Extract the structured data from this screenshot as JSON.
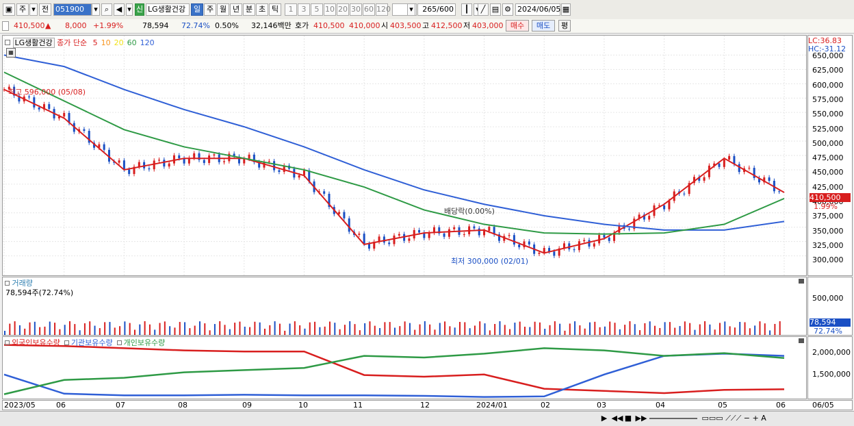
{
  "toolbar": {
    "period_buttons": [
      "주",
      "전"
    ],
    "code": "051900",
    "stock_badge": "신",
    "stock_name": "LG생활건강",
    "timeframes": [
      "일",
      "주",
      "월",
      "년",
      "분",
      "초",
      "틱"
    ],
    "active_timeframe": "일",
    "intervals": [
      "1",
      "3",
      "5",
      "10",
      "20",
      "30",
      "60",
      "120"
    ],
    "count": "265",
    "count_max": "/600",
    "date": "2024/06/05"
  },
  "info": {
    "price": "410,500",
    "change_arrow": "▲",
    "change": "8,000",
    "change_pct": "+1.99%",
    "volume": "78,594",
    "volume_pct": "72.74%",
    "turnover": "0.50%",
    "amount": "32,146백만",
    "quote_label": "호가",
    "ask": "410,500",
    "bid": "410,000",
    "open_label": "시",
    "open": "403,500",
    "high_label": "고",
    "high": "412,500",
    "low_label": "저",
    "low": "403,000",
    "buy_button": "매수",
    "sell_button": "매도",
    "eval_button": "평"
  },
  "price_panel": {
    "title": "LG생활건강",
    "ma_label": "종가 단순",
    "ma_periods": [
      {
        "label": "5",
        "color": "#d81e1e"
      },
      {
        "label": "10",
        "color": "#f7941d"
      },
      {
        "label": "20",
        "color": "#f2e21a"
      },
      {
        "label": "60",
        "color": "#2e9a45"
      },
      {
        "label": "120",
        "color": "#2f5fd6"
      }
    ],
    "lc": "LC:36.83",
    "hc": "HC:-31.12",
    "y_ticks": [
      "650,000",
      "625,000",
      "600,000",
      "575,000",
      "550,000",
      "525,000",
      "500,000",
      "475,000",
      "450,000",
      "425,000",
      "400,000",
      "375,000",
      "350,000",
      "325,000",
      "300,000"
    ],
    "current_price_tag": "410,500",
    "current_pct_tag": "1.99%",
    "annotation_high": "최고 596,000 (05/08)",
    "annotation_low": "최저 300,000 (02/01)",
    "annotation_dividend": "배당락(0.00%)"
  },
  "volume_panel": {
    "title": "거래량",
    "value": "78,594주(72.74%)",
    "y_tick": "500,000",
    "current_tag": "78,594",
    "current_pct": "72.74%"
  },
  "holdings_panel": {
    "legend": [
      {
        "label": "외국인보유수량",
        "color": "#d81e1e"
      },
      {
        "label": "기관보유수량",
        "color": "#2f5fd6"
      },
      {
        "label": "개인보유수량",
        "color": "#2e9a45"
      }
    ],
    "y_ticks": [
      "2,000,000",
      "1,500,000"
    ]
  },
  "x_axis": [
    "2023/05",
    "06",
    "07",
    "08",
    "09",
    "10",
    "11",
    "12",
    "2024/01",
    "02",
    "03",
    "04",
    "05",
    "06",
    "06/05"
  ],
  "chart_data": {
    "type": "line",
    "title": "",
    "x": [
      "2023/05",
      "06",
      "07",
      "08",
      "09",
      "10",
      "11",
      "12",
      "2024/01",
      "02",
      "03",
      "04",
      "05",
      "06"
    ],
    "series": [
      {
        "name": "종가",
        "values": [
          590000,
          540000,
          450000,
          470000,
          470000,
          440000,
          320000,
          340000,
          345000,
          305000,
          330000,
          390000,
          470000,
          410500
        ]
      },
      {
        "name": "120",
        "values": [
          650000,
          630000,
          590000,
          555000,
          525000,
          490000,
          450000,
          415000,
          390000,
          370000,
          355000,
          345000,
          345000,
          360000
        ]
      },
      {
        "name": "60",
        "values": [
          620000,
          570000,
          520000,
          490000,
          470000,
          450000,
          420000,
          380000,
          355000,
          340000,
          338000,
          340000,
          355000,
          400000
        ]
      },
      {
        "name": "외국인보유수량",
        "values": [
          2180000,
          2160000,
          2120000,
          2080000,
          2060000,
          2060000,
          1630000,
          1600000,
          1640000,
          1380000,
          1340000,
          1300000,
          1360000,
          1370000
        ]
      },
      {
        "name": "기관보유수량",
        "values": [
          1640000,
          1290000,
          1260000,
          1260000,
          1270000,
          1260000,
          1260000,
          1250000,
          1230000,
          1240000,
          1640000,
          1980000,
          2020000,
          1980000
        ]
      },
      {
        "name": "개인보유수량",
        "values": [
          1280000,
          1540000,
          1580000,
          1680000,
          1720000,
          1760000,
          1980000,
          1950000,
          2020000,
          2120000,
          2080000,
          1980000,
          2030000,
          1940000
        ]
      }
    ],
    "ylim": [
      290000,
      660000
    ]
  },
  "colors": {
    "up": "#d81e1e",
    "down": "#1a4fc4"
  }
}
